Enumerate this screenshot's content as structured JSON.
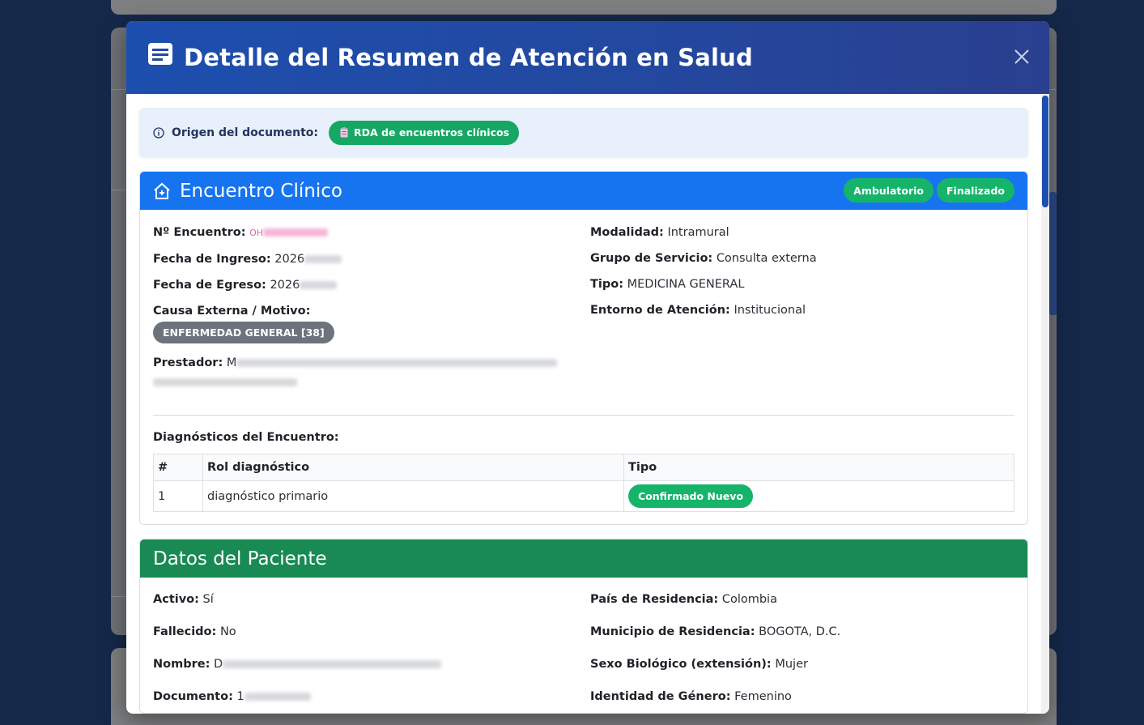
{
  "modal": {
    "title": "Detalle del Resumen de Atención en Salud",
    "close_label": "×"
  },
  "origin": {
    "label": "Origen del documento:",
    "value": "RDA de encuentros clínicos"
  },
  "encounter": {
    "title": "Encuentro Clínico",
    "badges": [
      "Ambulatorio",
      "Finalizado"
    ],
    "left_fields": [
      {
        "label": "Nº Encuentro:",
        "value": "OH"
      },
      {
        "label": "Fecha de Ingreso:",
        "value": "2026"
      },
      {
        "label": "Fecha de Egreso:",
        "value": "2026"
      }
    ],
    "cause_label": "Causa Externa / Motivo:",
    "cause_value": "ENFERMEDAD GENERAL [38]",
    "provider_label": "Prestador:",
    "provider_value_visible": "M",
    "right_fields": [
      {
        "label": "Modalidad:",
        "value": "Intramural"
      },
      {
        "label": "Grupo de Servicio:",
        "value": "Consulta externa"
      },
      {
        "label": "Tipo:",
        "value": "MEDICINA GENERAL"
      },
      {
        "label": "Entorno de Atención:",
        "value": "Institucional"
      }
    ],
    "diagnoses_title": "Diagnósticos del Encuentro:",
    "diagnoses_columns": [
      "#",
      "Rol diagnóstico",
      "Tipo"
    ],
    "diagnoses_rows": [
      {
        "num": "1",
        "role": "diagnóstico primario",
        "type": "Confirmado Nuevo"
      }
    ]
  },
  "patient": {
    "title": "Datos del Paciente",
    "rows": [
      {
        "left_label": "Activo:",
        "left_value": "Sí",
        "right_label": "País de Residencia:",
        "right_value": "Colombia"
      },
      {
        "left_label": "Fallecido:",
        "left_value": "No",
        "right_label": "Municipio de Residencia:",
        "right_value": "BOGOTA, D.C."
      },
      {
        "left_label": "Nombre:",
        "left_value": "D",
        "right_label": "Sexo Biológico (extensión):",
        "right_value": "Mujer"
      },
      {
        "left_label": "Documento:",
        "left_value": "1",
        "right_label": "Identidad de Género:",
        "right_value": "Femenino"
      }
    ]
  },
  "colors": {
    "header_gradient_start": "#1d4fae",
    "encounter_header": "#1774f0",
    "patient_header": "#1a8a55",
    "success_pill": "#16b36b",
    "neutral_pill": "#6c737c"
  }
}
